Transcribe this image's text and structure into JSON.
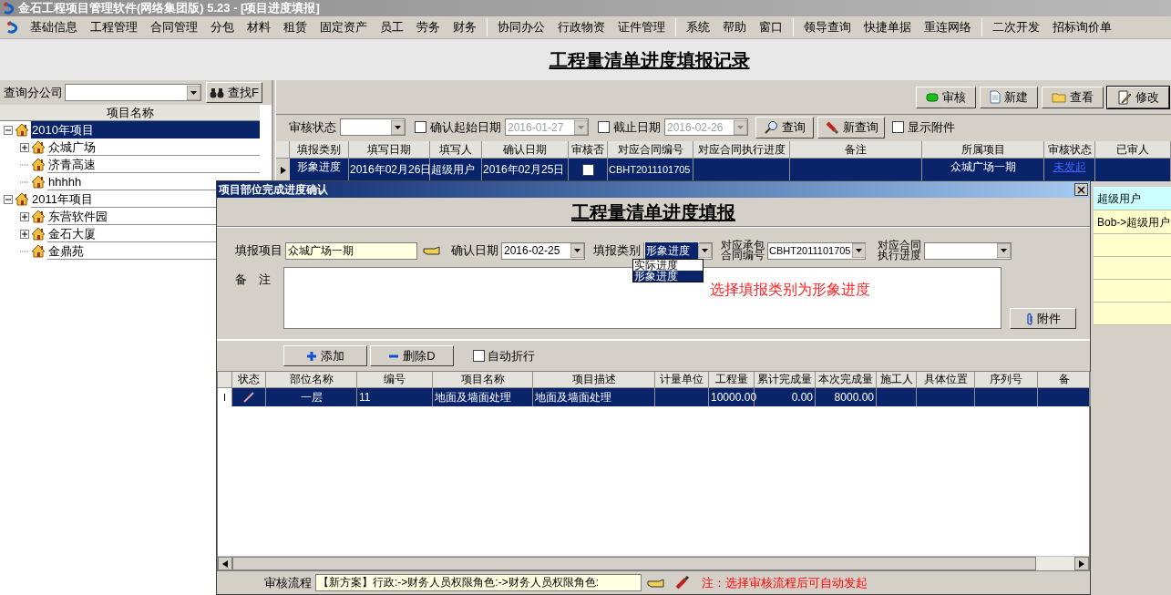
{
  "window": {
    "title": "金石工程项目管理软件(网络集团版) 5.23 - [项目进度填报]"
  },
  "menu_groups": [
    [
      "基础信息",
      "工程管理",
      "合同管理",
      "分包",
      "材料",
      "租赁",
      "固定资产",
      "员工",
      "劳务",
      "财务"
    ],
    [
      "协同办公",
      "行政物资",
      "证件管理"
    ],
    [
      "系统",
      "帮助",
      "窗口"
    ],
    [
      "领导查询",
      "快捷单据",
      "重连网络"
    ],
    [
      "二次开发",
      "招标询价单"
    ]
  ],
  "page_title": "工程量清单进度填报记录",
  "sidebar": {
    "branch_label": "查询分公司",
    "find_button": "查找F",
    "tree_header": "项目名称",
    "tree": [
      {
        "label": "2010年项目",
        "expandable": true,
        "expanded": true,
        "selected": true,
        "children": [
          {
            "label": "众城广场",
            "expandable": true,
            "expanded": false,
            "selected": false
          },
          {
            "label": "济青高速",
            "expandable": false,
            "selected": false
          },
          {
            "label": "hhhhh",
            "expandable": false,
            "selected": false
          }
        ]
      },
      {
        "label": "2011年项目",
        "expandable": true,
        "expanded": true,
        "selected": false,
        "children": [
          {
            "label": "东营软件园",
            "expandable": true,
            "expanded": false,
            "selected": false
          },
          {
            "label": "金石大厦",
            "expandable": true,
            "expanded": false,
            "selected": false
          },
          {
            "label": "金鼎苑",
            "expandable": false,
            "selected": false
          }
        ]
      }
    ]
  },
  "toolbar": [
    {
      "label": "审核",
      "focused": false
    },
    {
      "label": "新建",
      "focused": false
    },
    {
      "label": "查看",
      "focused": false
    },
    {
      "label": "修改",
      "focused": true
    }
  ],
  "filters": {
    "status_label": "审核状态",
    "start_date": {
      "label": "确认起始日期",
      "checked": false,
      "value": "2016-01-27",
      "disabled": true
    },
    "end_date": {
      "label": "截止日期",
      "checked": false,
      "value": "2016-02-26",
      "disabled": true
    },
    "search_button": "查询",
    "new_search_button": "新查询",
    "show_attachments": {
      "label": "显示附件",
      "checked": false
    }
  },
  "grid": {
    "columns": [
      "填报类别",
      "填写日期",
      "填写人",
      "确认日期",
      "审核否",
      "对应合同编号",
      "对应合同执行进度",
      "备注",
      "所属项目",
      "审核状态",
      "已审人"
    ],
    "rows": [
      {
        "selected": true,
        "type": "形象进度",
        "fill_date": "2016年02月26日",
        "filler": "超级用户",
        "confirm_date": "2016年02月25日",
        "audited": false,
        "contract_no": "CBHT2011101705",
        "project": "众城广场一期",
        "status": "未发起"
      }
    ]
  },
  "audit_rows": [
    {
      "text": "超级用户",
      "current": true
    },
    {
      "text": "Bob->超级用户",
      "current": false
    }
  ],
  "dialog": {
    "title": "项目部位完成进度确认",
    "heading": "工程量清单进度填报",
    "project_label": "填报项目",
    "project_value": "众城广场一期",
    "date_label": "确认日期",
    "date_value": "2016-02-25",
    "type_label": "填报类别",
    "type_value": "形象进度",
    "type_options": [
      {
        "label": "实际进度",
        "selected": false
      },
      {
        "label": "形象进度",
        "selected": true
      }
    ],
    "contract_label": [
      "对应承包",
      "合同编号"
    ],
    "contract_value": "CBHT2011101705",
    "progress_label": [
      "对应合同",
      "执行进度"
    ],
    "note_label": "备　注",
    "annotation": "选择填报类别为形象进度",
    "attach_button": "附件",
    "add_button": "添加",
    "delete_button": "删除D",
    "wrap": {
      "label": "自动折行",
      "checked": false
    },
    "columns": [
      "状态",
      "部位名称",
      "编号",
      "项目名称",
      "项目描述",
      "计量单位",
      "工程量",
      "累计完成量",
      "本次完成量",
      "施工人",
      "具体位置",
      "序列号",
      "备"
    ],
    "rows": [
      {
        "selected": true,
        "indicator": "I",
        "part": "一层",
        "code": "11",
        "name": "地面及墙面处理",
        "description": "地面及墙面处理",
        "quantity": "10000.00",
        "cumulative": "0.00",
        "current": "8000.00"
      }
    ],
    "flow_label": "审核流程",
    "flow_value": "【新方案】行政:->财务人员权限角色:->财务人员权限角色:",
    "flow_note": "注：选择审核流程后可自动发起"
  }
}
